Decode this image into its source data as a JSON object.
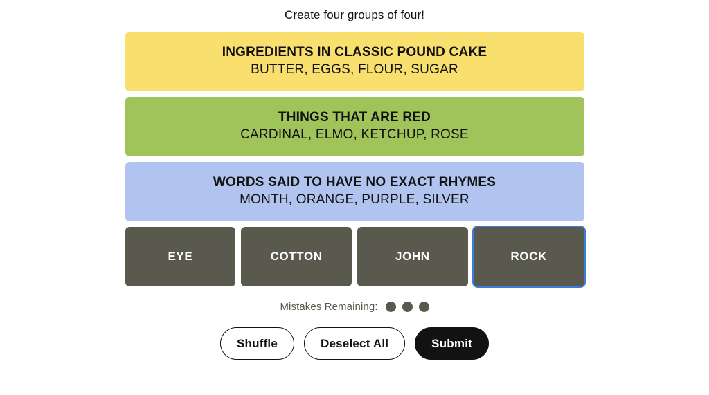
{
  "header": {
    "tagline": "Create four groups of four!"
  },
  "board": {
    "solved_groups": [
      {
        "title": "INGREDIENTS IN CLASSIC POUND CAKE",
        "members": "BUTTER, EGGS, FLOUR, SUGAR",
        "color": "#f9df6d",
        "difficulty": "yellow"
      },
      {
        "title": "THINGS THAT ARE RED",
        "members": "CARDINAL, ELMO, KETCHUP, ROSE",
        "color": "#a0c35a",
        "difficulty": "green"
      },
      {
        "title": "WORDS SAID TO HAVE NO EXACT RHYMES",
        "members": "MONTH, ORANGE, PURPLE, SILVER",
        "color": "#b0c4ef",
        "difficulty": "blue"
      }
    ],
    "tiles": [
      {
        "label": "EYE",
        "selected": false,
        "focused": false
      },
      {
        "label": "COTTON",
        "selected": false,
        "focused": false
      },
      {
        "label": "JOHN",
        "selected": false,
        "focused": false
      },
      {
        "label": "ROCK",
        "selected": false,
        "focused": true
      }
    ],
    "tile_color": "#5a594e",
    "tile_text_color": "#ffffff",
    "focus_ring_color": "#3c7ddb"
  },
  "mistakes": {
    "label": "Mistakes Remaining:",
    "remaining": 3,
    "total": 4,
    "dot_color": "#5a594e"
  },
  "controls": {
    "shuffle_label": "Shuffle",
    "deselect_label": "Deselect All",
    "submit_label": "Submit",
    "submit_bg": "#121212"
  }
}
